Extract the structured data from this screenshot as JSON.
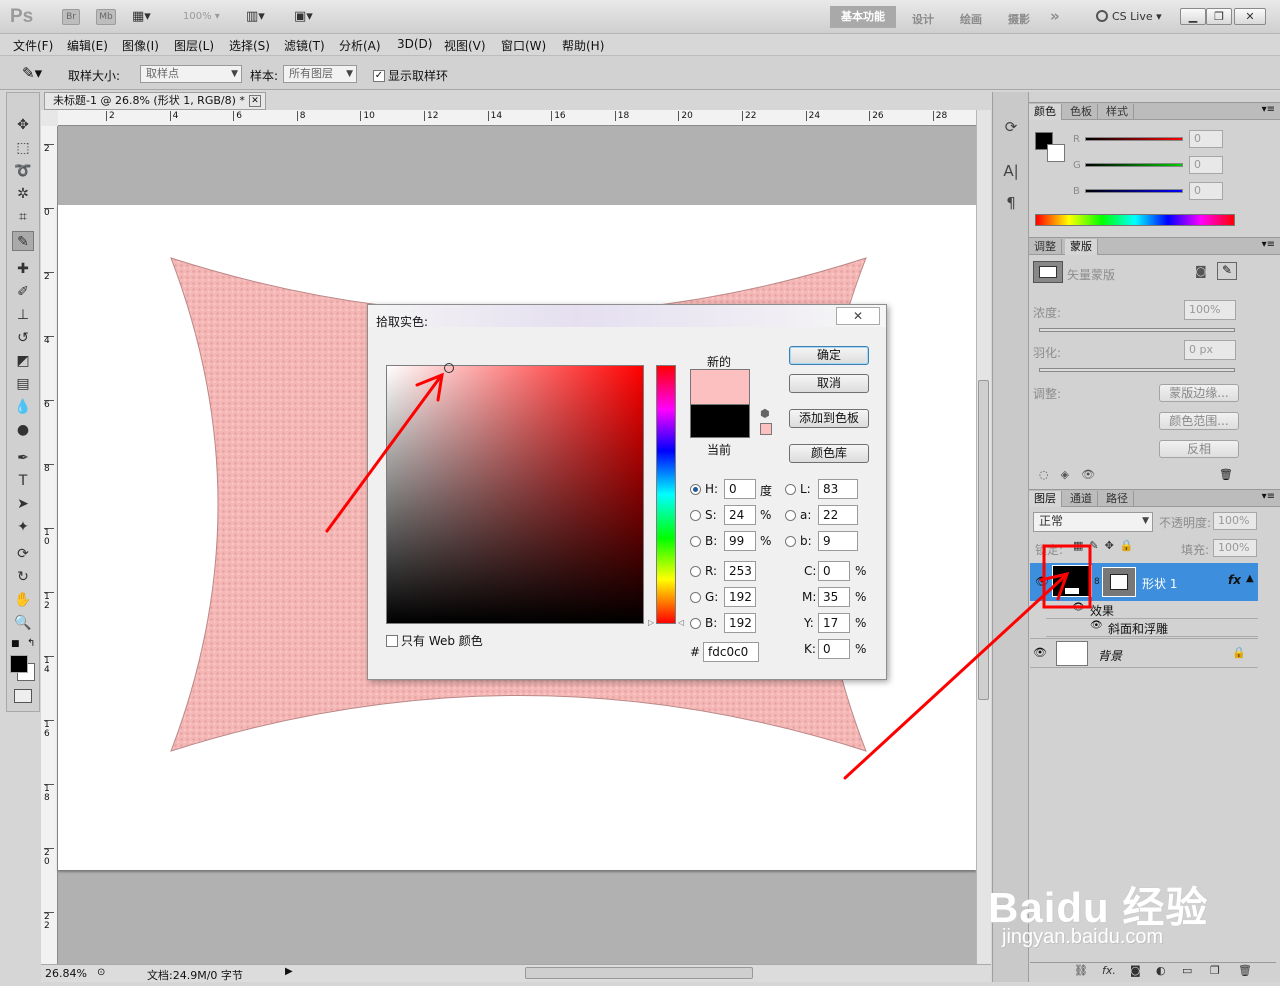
{
  "titlebar": {
    "app_logo": "Ps",
    "br_label": "Br",
    "mb_label": "Mb",
    "zoom": "100%",
    "workspace_active": "基本功能",
    "workspaces": [
      "设计",
      "绘画",
      "摄影"
    ],
    "more": "»",
    "cslive": "CS Live"
  },
  "menus": [
    "文件(F)",
    "编辑(E)",
    "图像(I)",
    "图层(L)",
    "选择(S)",
    "滤镜(T)",
    "分析(A)",
    "3D(D)",
    "视图(V)",
    "窗口(W)",
    "帮助(H)"
  ],
  "options": {
    "sample_size_label": "取样大小:",
    "sample_size_value": "取样点",
    "sample_label": "样本:",
    "sample_value": "所有图层",
    "show_ring_label": "显示取样环",
    "show_ring_checked": true
  },
  "document": {
    "tab_title": "未标题-1 @ 26.8% (形状 1, RGB/8) *",
    "ruler_h": [
      "2",
      "4",
      "6",
      "8",
      "10",
      "12",
      "14",
      "16",
      "18",
      "20",
      "22",
      "24",
      "26",
      "28"
    ],
    "ruler_v": [
      "2",
      "0",
      "2",
      "4",
      "6",
      "8",
      "10",
      "12",
      "14",
      "16",
      "18",
      "20",
      "22"
    ],
    "zoom": "26.84%",
    "doc_info": "文档:24.9M/0 字节"
  },
  "picker": {
    "title": "拾取实色:",
    "new_label": "新的",
    "current_label": "当前",
    "ok": "确定",
    "cancel": "取消",
    "add_swatch": "添加到色板",
    "color_libraries": "颜色库",
    "web_only": "只有 Web 颜色",
    "new_color": "#fdc0c0",
    "current_color": "#000000",
    "H": "0",
    "H_unit": "度",
    "S": "24",
    "S_unit": "%",
    "B": "99",
    "B_unit": "%",
    "L": "83",
    "a": "22",
    "b": "9",
    "R": "253",
    "G": "192",
    "Bv": "192",
    "C": "0",
    "M": "35",
    "Y": "17",
    "K": "0",
    "pct": "%",
    "hex": "fdc0c0"
  },
  "panels": {
    "color_tabs": [
      "颜色",
      "色板",
      "样式"
    ],
    "rgb_values": [
      "0",
      "0",
      "0"
    ],
    "rgb_labels": [
      "R",
      "G",
      "B"
    ],
    "adjust_tabs": [
      "调整",
      "蒙版"
    ],
    "vector_mask": "矢量蒙版",
    "density_label": "浓度:",
    "density_value": "100%",
    "feather_label": "羽化:",
    "feather_value": "0 px",
    "adjust_label": "调整:",
    "mask_edge": "蒙版边缘...",
    "color_range": "颜色范围...",
    "invert": "反相",
    "layer_tabs": [
      "图层",
      "通道",
      "路径"
    ],
    "blend_mode": "正常",
    "opacity_label": "不透明度:",
    "opacity_value": "100%",
    "lock_label": "锁定:",
    "fill_label": "填充:",
    "fill_value": "100%",
    "layer_shape": "形状 1",
    "fx": "fx",
    "effects": "效果",
    "bevel": "斜面和浮雕",
    "layer_bg": "背景"
  },
  "watermark": {
    "brand": "Baidu 经验",
    "url": "jingyan.baidu.com"
  },
  "colors": {
    "shape_fill": "#f4b7b5",
    "selected_layer": "#3d8fdd",
    "annotation": "#ff0000"
  }
}
